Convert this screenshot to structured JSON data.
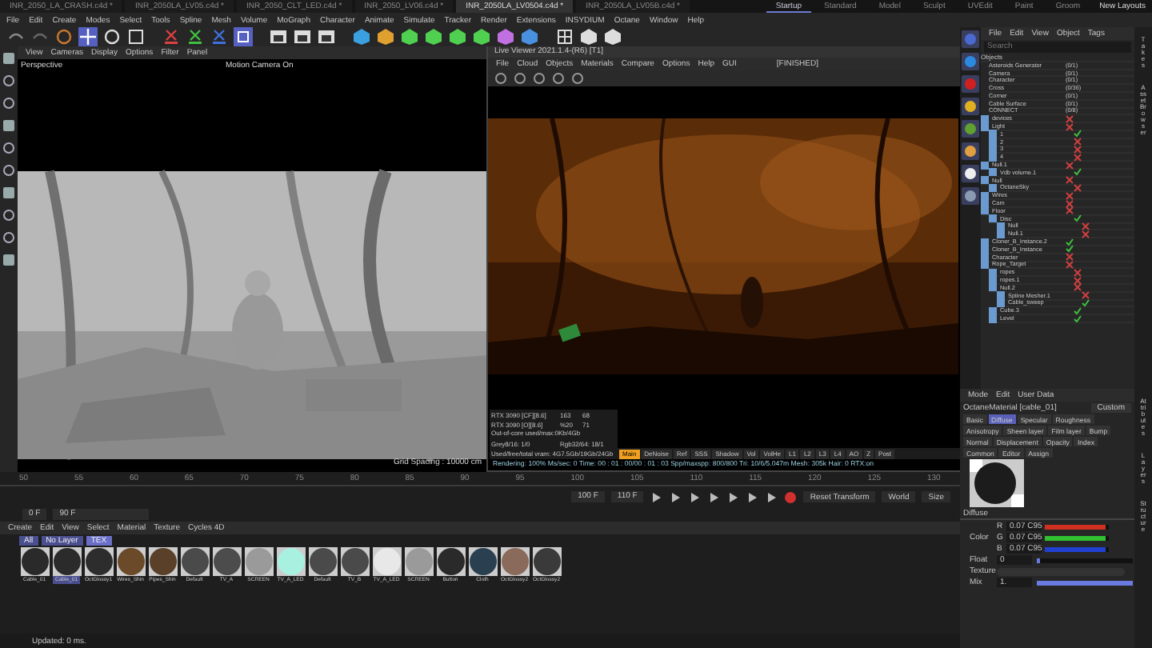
{
  "doc_tabs": [
    {
      "label": "INR_2050_LA_CRASH.c4d *",
      "selected": false
    },
    {
      "label": "INR_2050LA_LV05.c4d *",
      "selected": false
    },
    {
      "label": "INR_2050_CLT_LED.c4d *",
      "selected": false
    },
    {
      "label": "INR_2050_LV06.c4d *",
      "selected": false
    },
    {
      "label": "INR_2050LA_LV0504.c4d *",
      "selected": true
    },
    {
      "label": "INR_2050LA_LV05B.c4d *",
      "selected": false
    }
  ],
  "layout_tabs": [
    {
      "label": "Startup",
      "selected": true
    },
    {
      "label": "Standard",
      "selected": false
    },
    {
      "label": "Model",
      "selected": false
    },
    {
      "label": "Sculpt",
      "selected": false
    },
    {
      "label": "UVEdit",
      "selected": false
    },
    {
      "label": "Paint",
      "selected": false
    },
    {
      "label": "Groom",
      "selected": false
    }
  ],
  "new_layouts": "New Layouts",
  "menu": [
    "File",
    "Edit",
    "Create",
    "Modes",
    "Select",
    "Tools",
    "Spline",
    "Mesh",
    "Volume",
    "MoGraph",
    "Character",
    "Animate",
    "Simulate",
    "Tracker",
    "Render",
    "Extensions",
    "INSYDIUM",
    "Octane",
    "Window",
    "Help"
  ],
  "viewport": {
    "menu": [
      "View",
      "Cameras",
      "Display",
      "Options",
      "Filter",
      "Panel"
    ],
    "view_name": "Perspective",
    "camera": "Motion Camera On",
    "grid": "Grid Spacing : 10000 cm"
  },
  "live_viewer": {
    "title": "Live Viewer 2021.1.4-(R6) [T1]",
    "menu": [
      "File",
      "Cloud",
      "Objects",
      "Materials",
      "Compare",
      "Options",
      "Help",
      "GUI"
    ],
    "status": "[FINISHED]",
    "gpus": [
      {
        "name": "RTX 3090 [CF][8.6]",
        "c1": "163",
        "c2": "68"
      },
      {
        "name": "RTX 3090 [O][8.6]",
        "c1": "%20",
        "c2": "71"
      }
    ],
    "out_of_core": "Out-of-core used/max:0Kb/4Gb",
    "grey": "Grey8/16: 1/0",
    "rgb": "Rgb32/64: 18/1",
    "vram": "Used/free/total vram: 4G7.5Gb/19Gb/24Gb",
    "passes": [
      {
        "label": "Main",
        "selected": true
      },
      {
        "label": "DeNoise",
        "selected": false
      },
      {
        "label": "Ref",
        "selected": false
      },
      {
        "label": "SSS",
        "selected": false
      },
      {
        "label": "Shadow",
        "selected": false
      },
      {
        "label": "Vol",
        "selected": false
      },
      {
        "label": "VolHe",
        "selected": false
      },
      {
        "label": "L1",
        "selected": false
      },
      {
        "label": "L2",
        "selected": false
      },
      {
        "label": "L3",
        "selected": false
      },
      {
        "label": "L4",
        "selected": false
      },
      {
        "label": "AO",
        "selected": false
      },
      {
        "label": "Z",
        "selected": false
      },
      {
        "label": "Post",
        "selected": false
      }
    ],
    "rendering": "Rendering: 100% Ms/sec: 0 Time: 00 : 01 : 00/00 : 01 : 03 Spp/maxspp: 800/800 Tri: 10/6/5.047m Mesh: 305k Hair: 0 RTX:on"
  },
  "timeline": {
    "ticks": [
      "50",
      "55",
      "60",
      "65",
      "70",
      "75",
      "80",
      "85",
      "90",
      "95",
      "100",
      "105",
      "110",
      "115",
      "120",
      "125",
      "130"
    ],
    "start": "0 F",
    "end": "90 F",
    "current": "100 F",
    "max": "110 F",
    "reset": "Reset Transform",
    "space": "World",
    "size": "Size"
  },
  "materials": {
    "menu": [
      "Create",
      "Edit",
      "View",
      "Select",
      "Material",
      "Texture",
      "Cycles 4D"
    ],
    "filters": [
      {
        "label": "All",
        "selected": false
      },
      {
        "label": "No Layer",
        "selected": false
      },
      {
        "label": "TEX",
        "selected": true
      }
    ],
    "items": [
      {
        "name": "Cable_01",
        "color": "#2a2a2a",
        "selected": false
      },
      {
        "name": "Cable_01",
        "color": "#2b2b2b",
        "selected": true
      },
      {
        "name": "OctGlossy1",
        "color": "#2d2d2d",
        "selected": false
      },
      {
        "name": "Wires_Shin",
        "color": "#6b4a2a",
        "selected": false
      },
      {
        "name": "Pipes_Shin",
        "color": "#5a4028",
        "selected": false
      },
      {
        "name": "Default",
        "color": "#4a4a4a",
        "selected": false
      },
      {
        "name": "TV_A",
        "color": "#4c4c4c",
        "selected": false
      },
      {
        "name": "SCREEN",
        "color": "#9a9a9a",
        "selected": false
      },
      {
        "name": "TV_A_LED",
        "color": "#a8f0e0",
        "selected": false
      },
      {
        "name": "Default",
        "color": "#4a4a4a",
        "selected": false
      },
      {
        "name": "TV_B",
        "color": "#4a4a4a",
        "selected": false
      },
      {
        "name": "TV_A_LED",
        "color": "#e8e8e8",
        "selected": false
      },
      {
        "name": "SCREEN",
        "color": "#9a9a9a",
        "selected": false
      },
      {
        "name": "Button",
        "color": "#2a2a2a",
        "selected": false
      },
      {
        "name": "Cloth",
        "color": "#2a4050",
        "selected": false
      },
      {
        "name": "OctGlossy2",
        "color": "#8a6a5a",
        "selected": false
      },
      {
        "name": "OctGlossy2",
        "color": "#3a3a3a",
        "selected": false
      }
    ]
  },
  "status_bar": "Updated: 0 ms.",
  "objects": {
    "menu": [
      "File",
      "Edit",
      "View",
      "Object",
      "Tags"
    ],
    "search": "Search",
    "header": "Objects",
    "tree": [
      {
        "name": "Asteroids Generator",
        "count": "(0/1)"
      },
      {
        "name": "Camera",
        "count": "(0/1)"
      },
      {
        "name": "Character",
        "count": "(0/1)"
      },
      {
        "name": "Cross",
        "count": "(0/36)"
      },
      {
        "name": "Corner",
        "count": "(0/1)"
      },
      {
        "name": "Cable Surface",
        "count": "(0/1)"
      },
      {
        "name": "CONNECT",
        "count": "(0/8)"
      }
    ],
    "items": [
      {
        "name": "devices",
        "enabled": false
      },
      {
        "name": "Light",
        "enabled": false,
        "children": [
          {
            "name": "1",
            "enabled": true
          },
          {
            "name": "2",
            "enabled": false
          },
          {
            "name": "3",
            "enabled": false
          },
          {
            "name": "4",
            "enabled": false
          }
        ]
      },
      {
        "name": "Null.1",
        "enabled": false,
        "children": [
          {
            "name": "Vdb volume.1",
            "enabled": true
          }
        ]
      },
      {
        "name": "Null",
        "enabled": false,
        "children": [
          {
            "name": "OctaneSky",
            "enabled": false
          }
        ]
      },
      {
        "name": "Wires",
        "enabled": false
      },
      {
        "name": "Cam",
        "enabled": false
      },
      {
        "name": "Floor",
        "enabled": false,
        "children": [
          {
            "name": "Disc",
            "enabled": true,
            "children": [
              {
                "name": "Null",
                "enabled": false
              },
              {
                "name": "Null.1",
                "enabled": false
              }
            ]
          }
        ]
      },
      {
        "name": "Cloner_B_Instance.2",
        "enabled": true
      },
      {
        "name": "Cloner_B_Instance",
        "enabled": true
      },
      {
        "name": "Character",
        "enabled": false
      },
      {
        "name": "Rope_Target",
        "enabled": false,
        "children": [
          {
            "name": "ropes",
            "enabled": false
          },
          {
            "name": "ropes.1",
            "enabled": false
          },
          {
            "name": "Null.2",
            "enabled": false,
            "children": [
              {
                "name": "Spline Mesher.1",
                "enabled": false
              },
              {
                "name": "Cable_sweep",
                "enabled": true
              }
            ]
          },
          {
            "name": "Cube.3",
            "enabled": true
          },
          {
            "name": "Level",
            "enabled": true
          }
        ]
      }
    ]
  },
  "side_tabs_top": [
    "Takes",
    "Asset Browser"
  ],
  "attributes": {
    "menu": [
      "Mode",
      "Edit",
      "User Data"
    ],
    "material": "OctaneMaterial [cable_01]",
    "preset": "Custom",
    "tabs": [
      {
        "label": "Basic",
        "selected": false
      },
      {
        "label": "Diffuse",
        "selected": true
      },
      {
        "label": "Specular",
        "selected": false
      },
      {
        "label": "Roughness",
        "selected": false
      },
      {
        "label": "Anisotropy",
        "selected": false
      },
      {
        "label": "Sheen layer",
        "selected": false
      },
      {
        "label": "Film layer",
        "selected": false
      },
      {
        "label": "Bump",
        "selected": false
      },
      {
        "label": "Normal",
        "selected": false
      },
      {
        "label": "Displacement",
        "selected": false
      },
      {
        "label": "Opacity",
        "selected": false
      },
      {
        "label": "Index",
        "selected": false
      },
      {
        "label": "Common",
        "selected": false
      },
      {
        "label": "Editor",
        "selected": false
      },
      {
        "label": "Assign",
        "selected": false
      }
    ],
    "section": "Diffuse",
    "color_label": "Color",
    "channels": [
      {
        "label": "R",
        "value": "0.07 C95",
        "color": "#d03020",
        "level": 0.95
      },
      {
        "label": "G",
        "value": "0.07 C95",
        "color": "#30c030",
        "level": 0.95
      },
      {
        "label": "B",
        "value": "0.07 C95",
        "color": "#2040d0",
        "level": 0.95
      }
    ],
    "float": {
      "label": "Float",
      "value": "0",
      "level": 0.0
    },
    "texture_label": "Texture",
    "mix": {
      "label": "Mix",
      "value": "1.",
      "level": 1.0
    }
  },
  "side_tabs_bottom": [
    "Attributes",
    "Layers",
    "Structure"
  ]
}
